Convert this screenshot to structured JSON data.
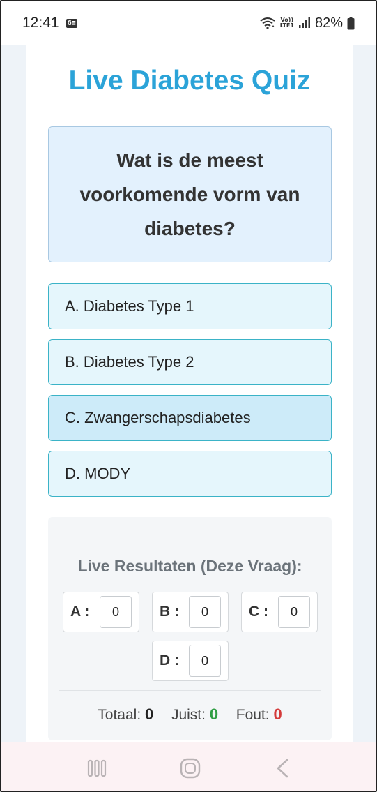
{
  "status_bar": {
    "time": "12:41",
    "notification_icon": "G≡",
    "volte_top": "Vo))",
    "volte_bottom": "LTE1",
    "battery": "82%"
  },
  "quiz": {
    "title": "Live Diabetes Quiz",
    "question": "Wat is de meest voorkomende vorm van diabetes?",
    "options": [
      {
        "label": "A. Diabetes Type 1",
        "selected": false
      },
      {
        "label": "B. Diabetes Type 2",
        "selected": false
      },
      {
        "label": "C. Zwangerschapsdiabetes",
        "selected": true
      },
      {
        "label": "D. MODY",
        "selected": false
      }
    ]
  },
  "results": {
    "title": "Live Resultaten (Deze Vraag):",
    "counts": [
      {
        "label": "A :",
        "value": "0"
      },
      {
        "label": "B :",
        "value": "0"
      },
      {
        "label": "C :",
        "value": "0"
      },
      {
        "label": "D :",
        "value": "0"
      }
    ],
    "totals": {
      "total_label": "Totaal:",
      "total_value": "0",
      "correct_label": "Juist:",
      "correct_value": "0",
      "wrong_label": "Fout:",
      "wrong_value": "0"
    }
  },
  "nav_bar": {
    "recents_icon": "recents-icon",
    "home_icon": "home-icon",
    "back_icon": "back-icon"
  },
  "colors": {
    "title": "#2ba3d8",
    "option_border": "#3bb3c7",
    "correct": "#2f9e44",
    "wrong": "#d43a3a"
  }
}
